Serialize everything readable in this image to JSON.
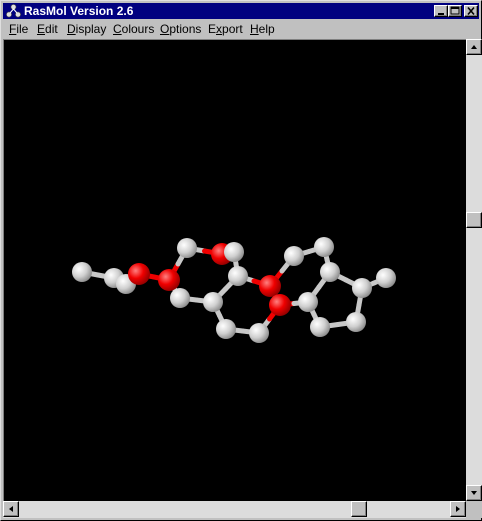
{
  "window": {
    "title": "RasMol Version 2.6",
    "controls": [
      "minimize-icon",
      "maximize-icon",
      "close-icon"
    ]
  },
  "menubar": {
    "items": [
      {
        "label": "File",
        "mnemonic": "F"
      },
      {
        "label": "Edit",
        "mnemonic": "E"
      },
      {
        "label": "Display",
        "mnemonic": "D"
      },
      {
        "label": "Colours",
        "mnemonic": "C"
      },
      {
        "label": "Options",
        "mnemonic": "O"
      },
      {
        "label": "Export",
        "mnemonic": "x"
      },
      {
        "label": "Help",
        "mnemonic": "H"
      }
    ]
  },
  "viewport": {
    "background": "#000000",
    "atom_colors": {
      "carbon": "#c8c8c8",
      "oxygen": "#f00000"
    },
    "scene": "ball-and-stick molecule"
  },
  "scrollbars": {
    "vertical_position": 0.38,
    "horizontal_position": 0.8
  },
  "colors": {
    "titlebar": "#000080",
    "chrome": "#c0c0c0"
  }
}
